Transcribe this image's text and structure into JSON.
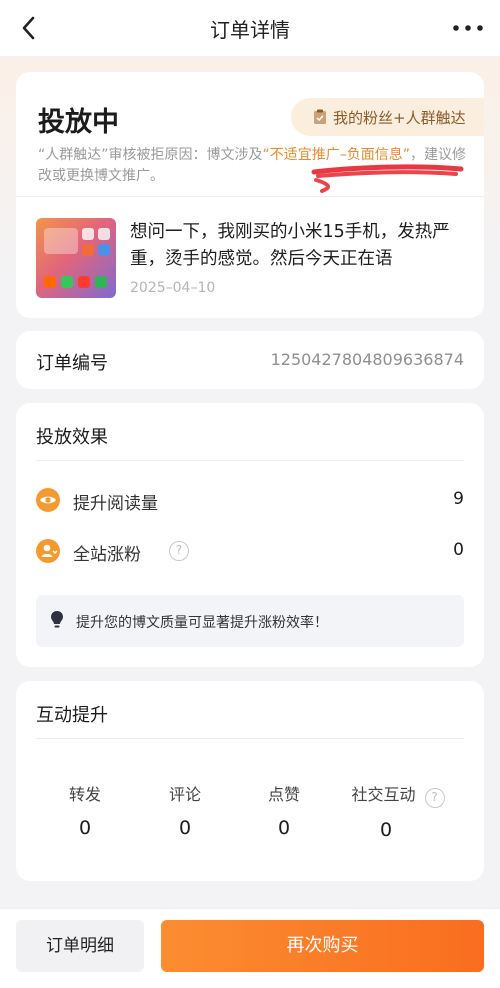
{
  "header": {
    "title": "订单详情",
    "back_icon": "back-arrow-icon",
    "more_icon": "more-dots-icon"
  },
  "status": {
    "title": "投放中",
    "target_label": "我的粉丝+人群触达",
    "reject_prefix": "“人群触达”审核被拒原因：博文涉及",
    "reject_highlight": "“不适宜推广–负面信息”",
    "reject_suffix": "，建议修改或更换博文推广。"
  },
  "post": {
    "text": "想问一下，我刚买的小米15手机，发热严重，烫手的感觉。然后今天正在语",
    "date": "2025–04–10"
  },
  "order": {
    "label": "订单编号",
    "number": "1250427804809636874"
  },
  "effect": {
    "title": "投放效果",
    "metrics": [
      {
        "label": "提升阅读量",
        "value": "9",
        "icon": "eye-icon"
      },
      {
        "label": "全站涨粉",
        "value": "0",
        "icon": "user-plus-icon",
        "help": "?"
      }
    ],
    "tip": "提升您的博文质量可显著提升涨粉效率！"
  },
  "interaction": {
    "title": "互动提升",
    "stats": [
      {
        "label": "转发",
        "value": "0"
      },
      {
        "label": "评论",
        "value": "0"
      },
      {
        "label": "点赞",
        "value": "0"
      },
      {
        "label": "社交互动",
        "value": "0",
        "help": "?"
      }
    ]
  },
  "actions": {
    "detail_label": "订单明细",
    "buy_label": "再次购买"
  },
  "colors": {
    "accent": "#f96d1f",
    "highlight": "#e98b2c",
    "scribble": "#e5242b"
  }
}
